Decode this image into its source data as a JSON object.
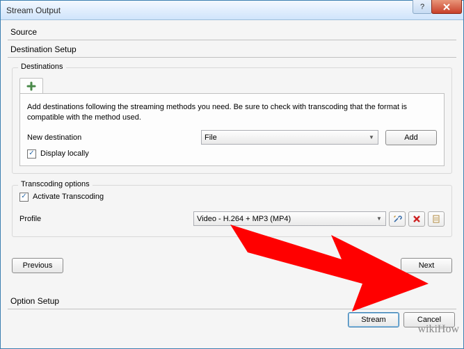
{
  "titlebar": {
    "title": "Stream Output"
  },
  "sections": {
    "source": "Source",
    "dest_setup": "Destination Setup",
    "option_setup": "Option Setup"
  },
  "destinations": {
    "group_label": "Destinations",
    "help": "Add destinations following the streaming methods you need. Be sure to check with transcoding that the format is compatible with the method used.",
    "new_label": "New destination",
    "new_value": "File",
    "add_label": "Add",
    "display_locally_label": "Display locally",
    "display_locally_checked": true
  },
  "transcoding": {
    "group_label": "Transcoding options",
    "activate_label": "Activate Transcoding",
    "activate_checked": true,
    "profile_label": "Profile",
    "profile_value": "Video - H.264 + MP3 (MP4)"
  },
  "nav": {
    "previous": "Previous",
    "next": "Next"
  },
  "footer": {
    "stream": "Stream",
    "cancel": "Cancel"
  },
  "watermark": "wikiHow"
}
